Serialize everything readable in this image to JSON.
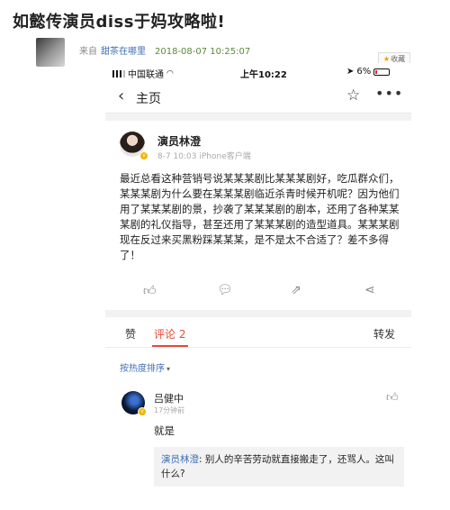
{
  "article": {
    "title": "如懿传演员diss于妈攻略啦!",
    "source_label": "来自",
    "source_name": "甜茶在哪里",
    "time": "2018-08-07 10:25:07",
    "fav_label": "收藏"
  },
  "status_bar": {
    "carrier": "中国联通",
    "time": "上午10:22",
    "battery": "6%"
  },
  "nav": {
    "back_title": "主页"
  },
  "post": {
    "author": "演员林澄",
    "meta": "8-7 10:03  iPhone客户端",
    "text": "最近总看这种营销号说某某某剧比某某某剧好，吃瓜群众们，某某某剧为什么要在某某某剧临近杀青时候开机呢？因为他们用了某某某剧的景，抄袭了某某某剧的剧本，还用了各种某某某剧的礼仪指导，甚至还用了某某某剧的造型道具。某某某剧现在反过来买黑粉踩某某某，是不是太不合适了？差不多得了！"
  },
  "tabs": {
    "like": "赞",
    "comment": "评论 2",
    "repost": "转发"
  },
  "comments": {
    "sort_label": "按热度排序",
    "items": [
      {
        "name": "吕健中",
        "time": "17分钟前",
        "text": "就是",
        "reply_author": "演员林澄",
        "reply_text": ": 别人的辛苦劳动就直接搬走了，还骂人。这叫什么?"
      }
    ]
  },
  "colors": {
    "accent_red": "#e34a3a",
    "link_blue": "#3f6fb5",
    "verified_gold": "#f5b400"
  }
}
